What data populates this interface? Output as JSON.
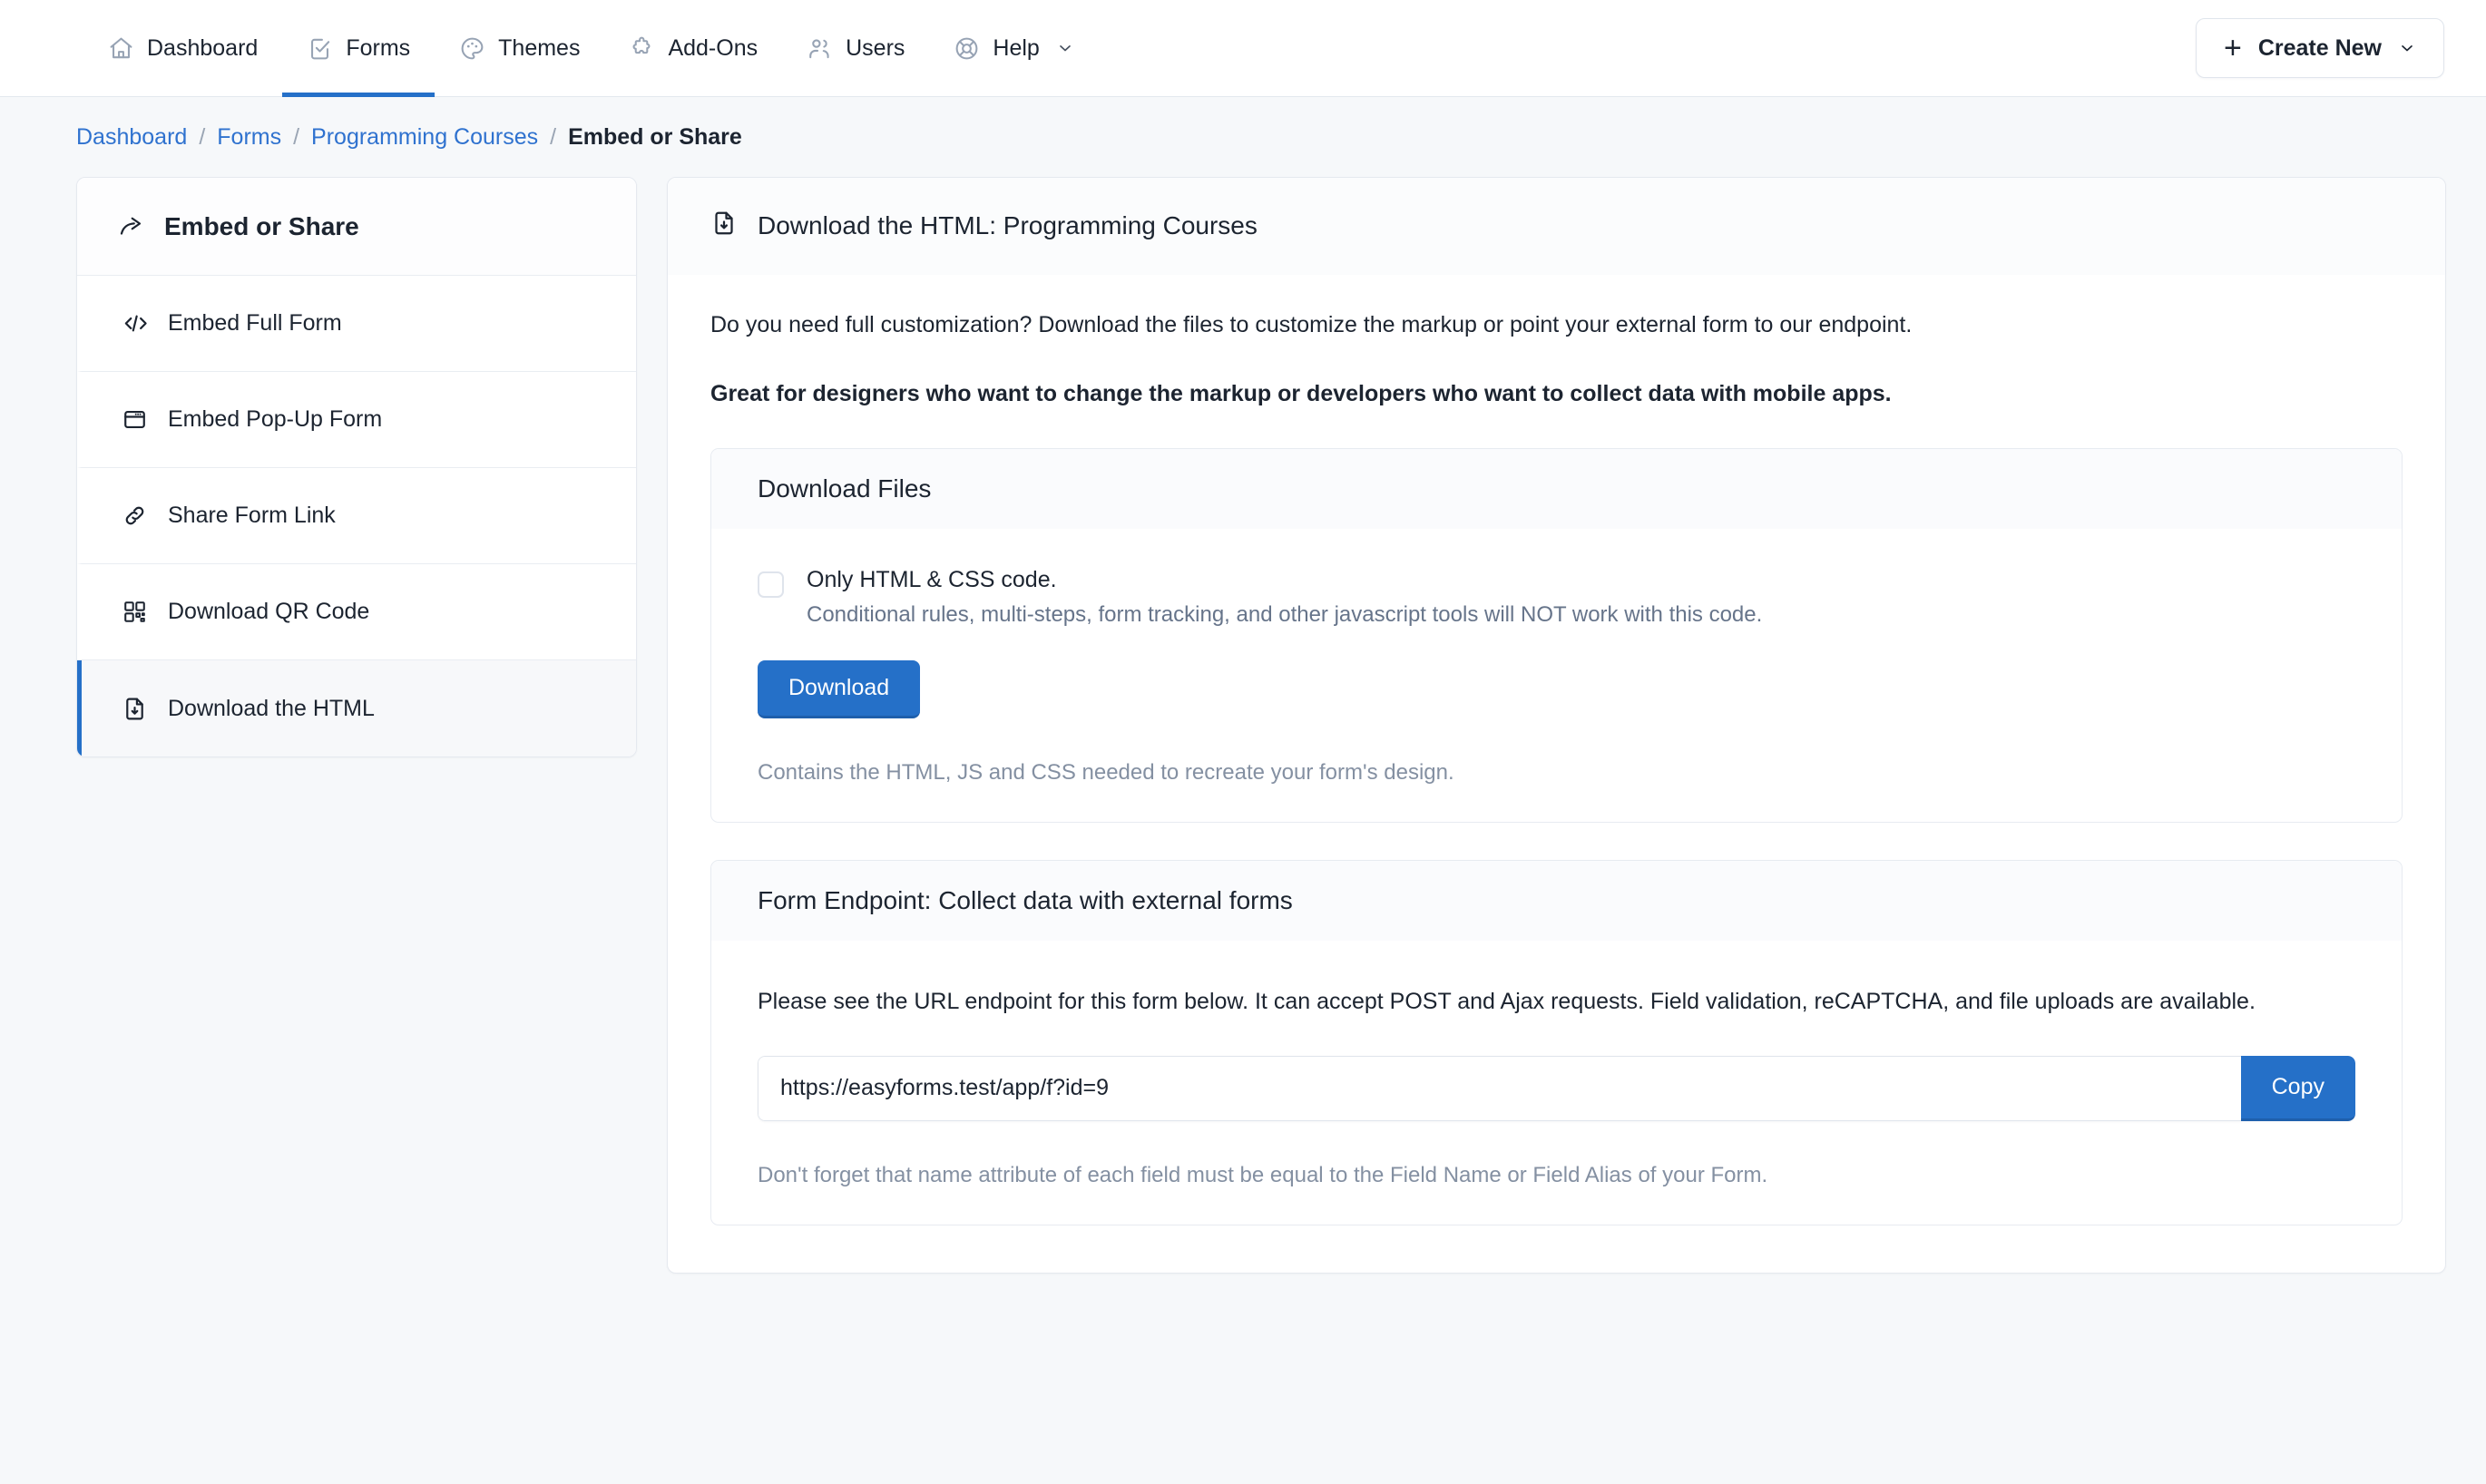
{
  "topnav": {
    "items": [
      {
        "label": "Dashboard",
        "icon": "home-icon",
        "active": false
      },
      {
        "label": "Forms",
        "icon": "form-check-icon",
        "active": true
      },
      {
        "label": "Themes",
        "icon": "palette-icon",
        "active": false
      },
      {
        "label": "Add-Ons",
        "icon": "puzzle-icon",
        "active": false
      },
      {
        "label": "Users",
        "icon": "users-icon",
        "active": false
      },
      {
        "label": "Help",
        "icon": "lifebuoy-icon",
        "active": false,
        "caret": true
      }
    ],
    "create_button": {
      "label": "Create New",
      "plus": "+",
      "caret": true
    }
  },
  "breadcrumb": {
    "items": [
      {
        "label": "Dashboard",
        "current": false
      },
      {
        "label": "Forms",
        "current": false
      },
      {
        "label": "Programming Courses",
        "current": false
      },
      {
        "label": "Embed or Share",
        "current": true
      }
    ],
    "separator": "/"
  },
  "sidebar": {
    "header": {
      "label": "Embed or Share",
      "icon": "share-arrow-icon"
    },
    "items": [
      {
        "label": "Embed Full Form",
        "icon": "code-brackets-icon",
        "active": false
      },
      {
        "label": "Embed Pop-Up Form",
        "icon": "window-popup-icon",
        "active": false
      },
      {
        "label": "Share Form Link",
        "icon": "link-chain-icon",
        "active": false
      },
      {
        "label": "Download QR Code",
        "icon": "qr-code-icon",
        "active": false
      },
      {
        "label": "Download the HTML",
        "icon": "file-download-icon",
        "active": true
      }
    ]
  },
  "main": {
    "header": {
      "title": "Download the HTML: Programming Courses",
      "icon": "file-download-icon"
    },
    "lead": "Do you need full customization? Download the files to customize the markup or point your external form to our endpoint.",
    "lead_strong": "Great for designers who want to change the markup or developers who want to collect data with mobile apps.",
    "download_panel": {
      "title": "Download Files",
      "checkbox": {
        "checked": false,
        "label": "Only HTML & CSS code.",
        "sublabel": "Conditional rules, multi-steps, form tracking, and other javascript tools will NOT work with this code."
      },
      "button_label": "Download",
      "note": "Contains the HTML, JS and CSS needed to recreate your form's design."
    },
    "endpoint_panel": {
      "title": "Form Endpoint: Collect data with external forms",
      "description": "Please see the URL endpoint for this form below. It can accept POST and Ajax requests. Field validation, reCAPTCHA, and file uploads are available.",
      "url_value": "https://easyforms.test/app/f?id=9",
      "url_placeholder": "https://easyforms.test/app/f?id=9",
      "copy_label": "Copy",
      "note": "Don't forget that name attribute of each field must be equal to the Field Name or Field Alias of your Form."
    }
  },
  "colors": {
    "accent": "#2570c8",
    "page_bg": "#f6f8fa",
    "text": "#1c2430",
    "muted": "#8490a2",
    "link": "#2f72cf"
  }
}
